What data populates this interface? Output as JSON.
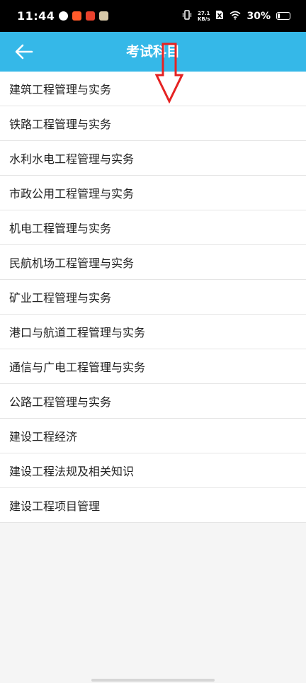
{
  "status_bar": {
    "time": "11:44",
    "net_speed_value": "27.1",
    "net_speed_unit": "KB/s",
    "battery_percent": "30%",
    "battery_level": 0.3,
    "app_icon_colors": [
      "#ffffff",
      "#ff5a2a",
      "#e8412c",
      "#d8c9a8"
    ]
  },
  "header": {
    "title": "考试科目",
    "background_color": "#35b8e8",
    "back_icon": "arrow-left-icon"
  },
  "annotation": {
    "icon": "down-arrow-annotation-icon",
    "color": "#e52222"
  },
  "subjects": [
    "建筑工程管理与实务",
    "铁路工程管理与实务",
    "水利水电工程管理与实务",
    "市政公用工程管理与实务",
    "机电工程管理与实务",
    "民航机场工程管理与实务",
    "矿业工程管理与实务",
    "港口与航道工程管理与实务",
    "通信与广电工程管理与实务",
    "公路工程管理与实务",
    "建设工程经济",
    "建设工程法规及相关知识",
    "建设工程项目管理"
  ]
}
